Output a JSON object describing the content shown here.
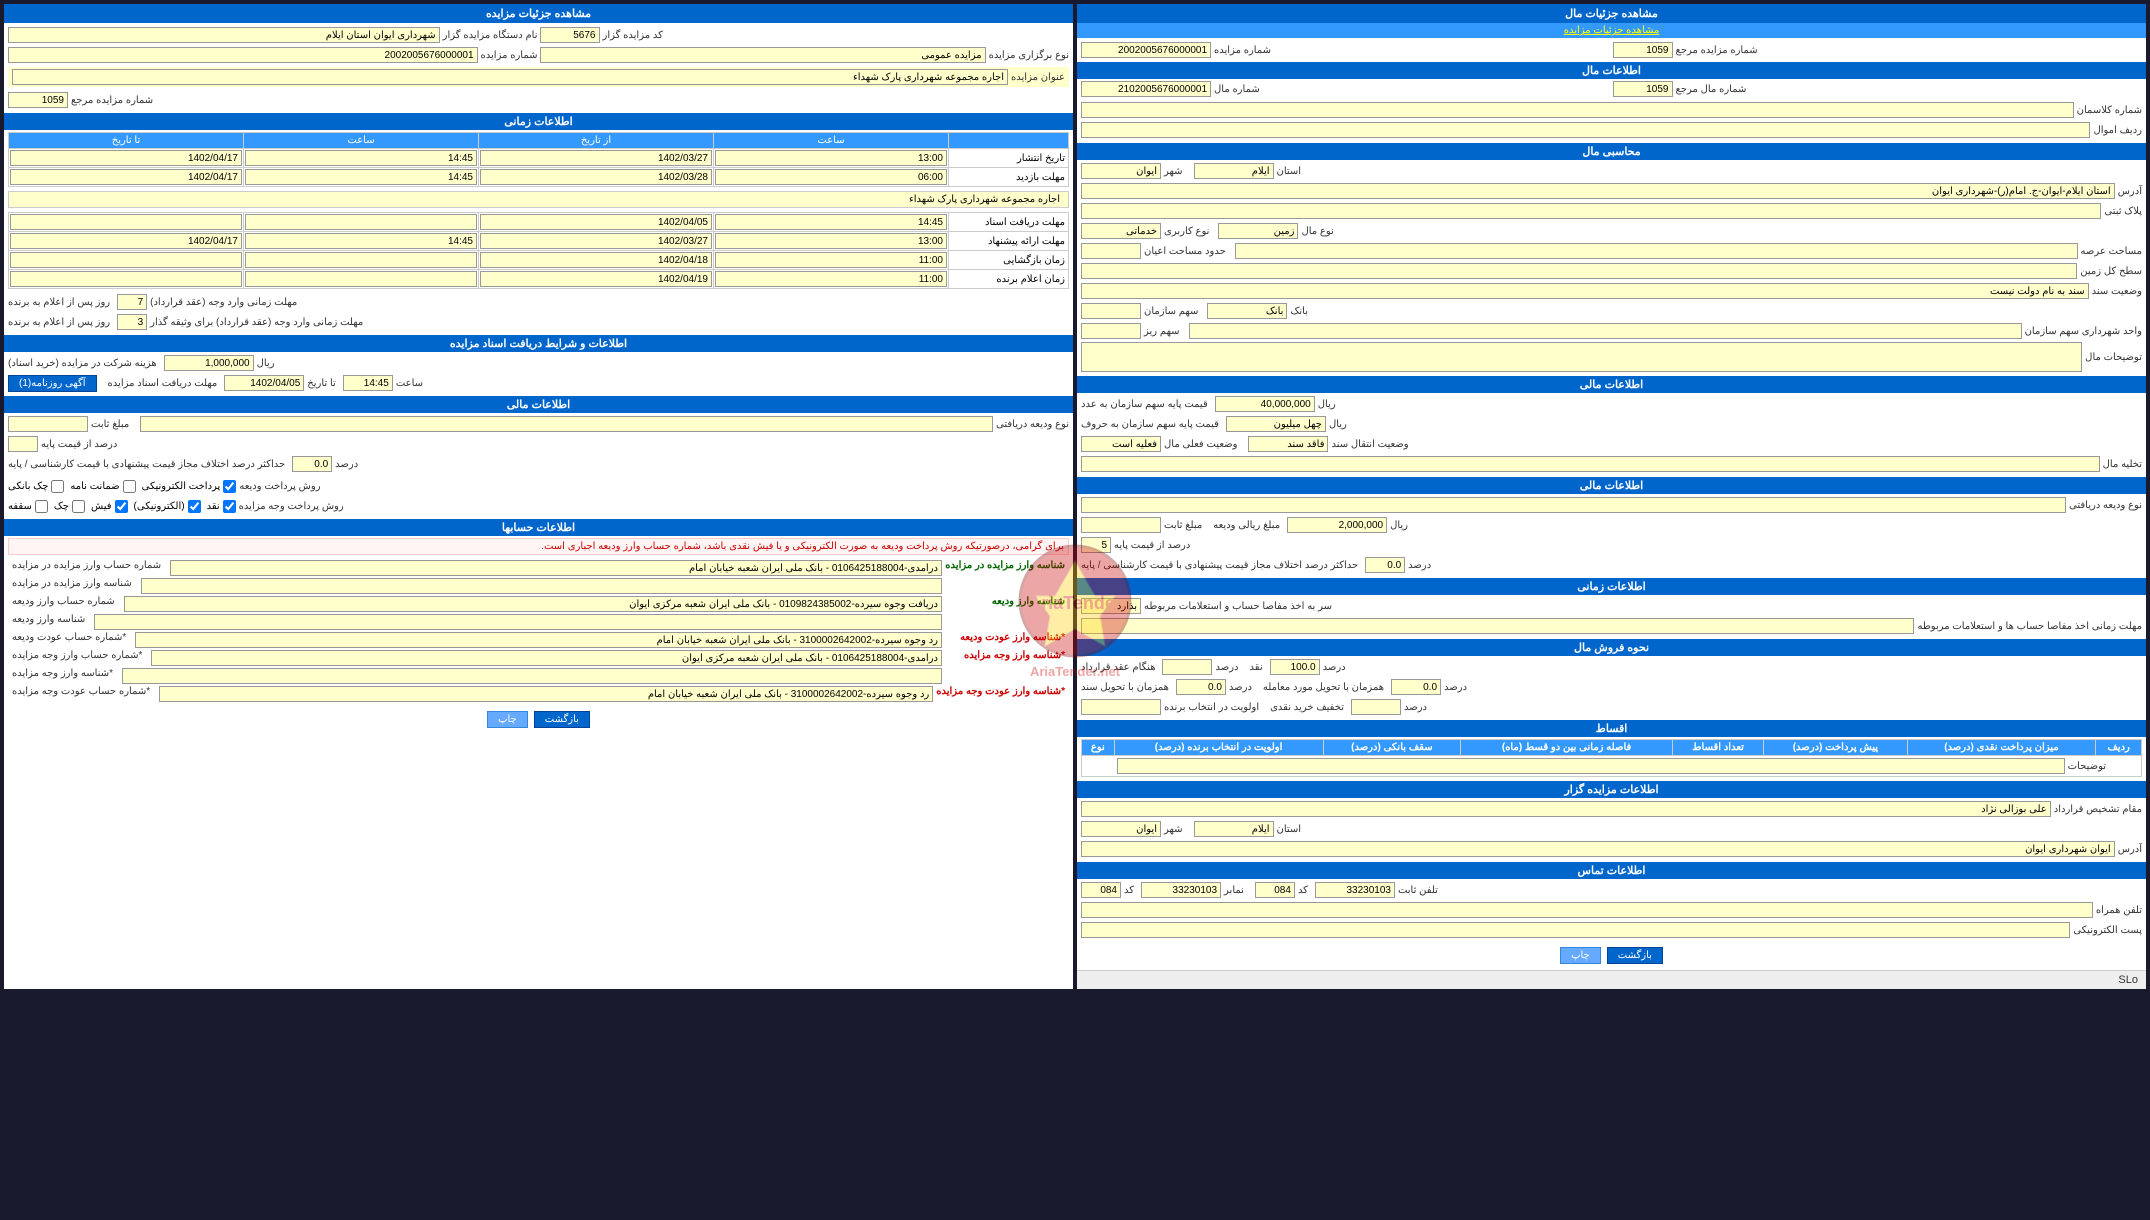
{
  "left_panel": {
    "main_header": "مشاهده جزئیات مال",
    "sub_link": "مشاهده جزئیات مزایده",
    "auction_number_label": "شماره مزایده",
    "auction_number_value": "2002005676000001",
    "ref_number_label": "شماره مزایده مرجع",
    "ref_number_value": "1059",
    "mal_info_header": "اطلاعات مال",
    "mal_number_label": "شماره مال",
    "mal_number_value": "2102005676000001",
    "mal_ref_label": "شماره مال مرجع",
    "mal_ref_value": "1059",
    "classnumber_label": "شماره کلاسمان",
    "amval_label": "ردیف اموال",
    "mohasebe_header": "محاسبی مال",
    "ostan_label": "استان",
    "ostan_value": "ایلام",
    "shahr_label": "شهر",
    "shahr_value": "ایوان",
    "address_label": "آدرس",
    "address_value": "استان ایلام-ایوان-ج. امام(ر)-شهرداری ایوان",
    "pelak_label": "پلاک ثبتی",
    "nowmal_label": "نوع مال",
    "nowmal_value": "زمین",
    "masahat_araz_label": "مساحت عرصه",
    "sathlabel": "سطح کل زمین",
    "vaziat_label": "وضعیت سند",
    "vaziat_value": "سند به نام دولت نیست",
    "bank_label": "بانک",
    "sahm_sazman_label": "سهم سازمان",
    "sahm_riz_label": "سهم ریز",
    "vahed_label": "واحد شهرداری سهم سازمان",
    "tozi_label": "توضیحات مال",
    "maliyat_header": "اطلاعات مالی",
    "price_base_label": "قیمت پایه سهم سازمان به عدد",
    "price_base_value": "40,000,000",
    "price_base_unit": "ریال",
    "price_million_label": "قیمت پایه سهم سازمان به حروف",
    "price_million_value": "چهل میلیون",
    "price_million_unit": "ریال",
    "entegal_label": "وضعیت انتقال سند",
    "entegal_value": "فاقد سند",
    "faghl_label": "وضعیت فعلی مال",
    "faghl_value": "فعلیه است",
    "tahliye_label": "تخلیه مال",
    "mal_financial_header": "اطلاعات مالی",
    "nowvarize_label": "نوع ودیعه دریافتی",
    "mablagh_riyali_label": "مبلغ ریالی ودیعه",
    "mablagh_riyali_value": "2,000,000",
    "mablagh_unit": "ریال",
    "sabt_label": "مبلغ ثابت",
    "darsd_az_ghimat_label": "درصد از قیمت پایه",
    "darsd_value": "5",
    "hadadaksar_label": "حداکثر درصد اختلاف مجاز قیمت پیشنهادی با قیمت کارشناسی / پایه",
    "hadadaksar_value": "0.0",
    "hadadaksar_unit": "درصد",
    "zamani_header": "اطلاعات زمانی",
    "bar_hesab_label": "سر به اخذ مفاصا حساب و استعلامات مربوطه",
    "bar_hesab_value": "بذارد",
    "mohlat_label": "مهلت زمانی اخذ مفاصا حساب ها و استعلامات مربوطه",
    "forosh_header": "نحوه فروش مال",
    "naghd_label": "نقد",
    "naghd_value": "100.0",
    "naghd_unit": "درصد",
    "aqd_label": "هنگام عقد قرارداد",
    "aqd_unit": "درصد",
    "tahvil_amel_label": "همزمان با تحویل مورد معامله",
    "tahvil_amel_value": "0.0",
    "tahvil_amel_unit": "درصد",
    "tahvil_sanad_label": "همزمان با تحویل سند",
    "tahvil_sanad_value": "0.0",
    "tahvil_sanad_unit": "درصد",
    "takhfif_label": "تخفیف خرید نقدی",
    "takhfif_unit": "درصد",
    "barande_label": "اولویت در انتخاب برنده",
    "agsaat_header": "اقساط",
    "table_headers": [
      "ردیف",
      "میزان پرداخت نقدی (درصد)",
      "پیش پرداخت (درصد)",
      "تعداد اقساط",
      "فاصله زمانی بین دو قسط (ماه)",
      "سقف بانکی (درصد)",
      "اولویت در انتخاب برنده (درصد)",
      "نوع"
    ],
    "tozi_row": "توضیحات",
    "contractor_header": "اطلاعات مزایده گزار",
    "moghdam_label": "مقام تشخیص قرارداد",
    "moghdam_value": "علی بوزالی نژاد",
    "ostan2_label": "استان",
    "ostan2_value": "ایلام",
    "shahr2_label": "شهر",
    "shahr2_value": "ایوان",
    "address2_label": "آدرس",
    "address2_value": "ایوان شهرداری ایوان",
    "contact_header": "اطلاعات تماس",
    "tel_sabt_label": "تلفن ثابت",
    "tel_sabt_code": "084",
    "tel_sabt_value": "33230103",
    "namabar_label": "نمابر",
    "namabar_code": "084",
    "namabar_value": "33230103",
    "tel_hamrah_label": "تلفن همراه",
    "email_label": "پست الکترونیکی",
    "print_btn": "چاپ",
    "back_btn": "بازگشت"
  },
  "right_panel": {
    "main_header": "مشاهده جزئیات مزایده",
    "kod_label": "کد مزایده گزار",
    "kod_value": "5676",
    "name_label": "نام دستگاه مزایده گزار",
    "name_value": "شهرداری ایوان استان ایلام",
    "nowtype_label": "نوع برگزاری مزایده",
    "nowtype_value": "مزایده عمومی",
    "auction_num_label": "شماره مزایده",
    "auction_num_value": "2002005676000001",
    "mozu_label": "عنوان مزایده",
    "mozu_value": "اجاره مجموعه شهرداری پارک شهداء",
    "ref_num_label": "شماره مزایده مرجع",
    "ref_num_value": "1059",
    "zamani_header": "اطلاعات زمانی",
    "date_headers": [
      "از تاریخ",
      "ساعت",
      "تا تاریخ",
      "ساعت"
    ],
    "tarikh_eshaar_label": "تاریخ انتشار",
    "tarikh_eshaar_az": "1402/03/27",
    "tarikh_eshaar_az_saat": "13:00",
    "tarikh_eshaar_ta": "1402/04/17",
    "tarikh_eshaar_ta_saat": "14:45",
    "mohlat_label": "مهلت بازدید",
    "mohlat_az": "1402/03/28",
    "mohlat_az_saat": "06:00",
    "mohlat_ta": "1402/04/17",
    "mohlat_ta_saat": "14:45",
    "tozi_mozu": "اجاره مجموعه شهرداری پارک شهداء",
    "mohlat_dariyaft_label": "مهلت دریافت اسناد",
    "mohlat_dariyaft_az": "1402/04/05",
    "mohlat_dariyaft_az_saat": "14:45",
    "mohlat_dariyaft_ta": "",
    "mohlat_dariyaft_ta_saat": "",
    "mohlat_arsal_label": "مهلت ارائه پیشنهاد",
    "mohlat_arsal_az": "1402/03/27",
    "mohlat_arsal_az_saat": "13:00",
    "mohlat_arsal_ta": "1402/04/17",
    "mohlat_arsal_ta_saat": "14:45",
    "zaman_bazgoshaii_label": "زمان بازگشایی",
    "zaman_bazgoshaii_az": "1402/04/18",
    "zaman_bazgoshaii_az_saat": "11:00",
    "zaman_eelam_label": "زمان اعلام برنده",
    "zaman_eelam_az": "1402/04/19",
    "zaman_eelam_az_saat": "11:00",
    "mohlat_barandeh_label": "مهلت زمانی وارد وجه (عقد قرارداد)",
    "mohlat_barandeh_value": "7",
    "mohlat_barandeh_unit": "روز پس از اعلام به برنده",
    "mohlat_vaghineh_label": "مهلت زمانی وارد وجه (عقد قرارداد) برای وثیقه گذار",
    "mohlat_vaghineh_value": "3",
    "mohlat_vaghineh_unit": "روز پس از اعلام به برنده",
    "asnad_header": "اطلاعات و شرایط دریافت اسناد مزایده",
    "hoghoogh_label": "هزینه شرکت در مزایده (خرید اسناد)",
    "hoghoogh_value": "1,000,000",
    "hoghoogh_unit": "ریال",
    "mohlat_asnad_label": "مهلت دریافت اسناد مزایده",
    "mohlat_asnad_az": "1402/04/05",
    "mohlat_asnad_ta_saat": "14:45",
    "agahi_btn": "آگهی روزنامه(1)",
    "mali_header": "اطلاعات مالی",
    "nowvarize_label": "نوع ودیعه دریافتی",
    "sabt_label": "مبلغ ثابت",
    "darsd_label": "درصد از قیمت پایه",
    "hadadaksar_label": "حداکثر درصد اختلاف مجاز قیمت پیشنهادی با قیمت کارشناسی / پایه",
    "hadadaksar_value": "0.0",
    "hadadaksar_unit": "درصد",
    "pay_methods_label": "روش پرداخت ودیعه",
    "pay_elect": "پرداخت الکترونیکی",
    "pay_zimani": "ضمانت نامه",
    "pay_check": "چک بانکی",
    "pay_pish_label": "روش پرداخت وجه مزایده",
    "pay_naghd": "نقد",
    "pay_elect2": "(الکترونیکی)",
    "pay_pish": "فیش",
    "pay_check2": "چک",
    "pay_saqfeh": "سقفه",
    "hesabat_header": "اطلاعات حسابها",
    "hesab_note": "برای گرامی، درصورتیکه روش پرداخت ودیعه به صورت الکترونیکی و یا فیش نقدی باشد، شماره حساب وارز ودیعه اجباری است.",
    "account_rows": [
      {
        "label": "شماره حساب وارز مزایده در مزایده",
        "value": "درآمدی-0106425188004 - بانک ملی ایران شعبه خیابان امام"
      },
      {
        "label": "شناسه وارز مزایده در مزایده",
        "value": ""
      },
      {
        "label": "شماره حساب وارز ودیعه",
        "value": "دریافت وجوه سیرده-0109824385002 - بانک ملی ایران شعبه مرکزی ایوان"
      },
      {
        "label": "شناسه وارز ودیعه",
        "value": ""
      },
      {
        "label": "*شماره حساب عودت ودیعه",
        "value": "رد وجوه سیرده-3100002642002 - بانک ملی ایران شعبه خیابان امام"
      },
      {
        "label": "*شماره حساب وارز وجه مزایده",
        "value": "درآمدی-0106425188004 - بانک ملی ایران شعبه مرکزی ایوان"
      },
      {
        "label": "*شناسه وارز وجه مزایده",
        "value": ""
      },
      {
        "label": "*شماره حساب عودت وجه مزایده",
        "value": "رد وجوه سیرده-3100002642002 - بانک ملی ایران شعبه خیابان امام"
      }
    ],
    "print_btn": "چاپ",
    "back_btn": "بازگشت"
  }
}
